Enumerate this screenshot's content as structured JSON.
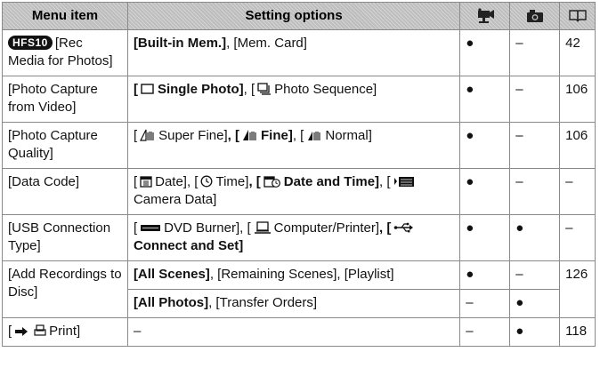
{
  "header": {
    "menu_item": "Menu item",
    "setting_options": "Setting options",
    "video_mode_icon": "video-camera-icon",
    "photo_mode_icon": "still-camera-icon",
    "page_ref_icon": "book-icon"
  },
  "rows": [
    {
      "item_badge": "HFS10",
      "item": "[Rec Media for Photos]",
      "opt_1": "[Built-in Mem.]",
      "opt_2": ", [Mem. Card]",
      "video": "●",
      "photo": "–",
      "page": "42"
    },
    {
      "item": "[Photo Capture from Video]",
      "opt_1_open": "[",
      "opt_1": "Single Photo]",
      "opt_2_open": ", [",
      "opt_2": "Photo Sequence]",
      "video": "●",
      "photo": "–",
      "page": "106"
    },
    {
      "item": "[Photo Capture Quality]",
      "opt_1_open": "[",
      "opt_1": "Super Fine]",
      "opt_2_open": ", [",
      "opt_2": "Fine]",
      "opt_3_open": ", [",
      "opt_3": "Normal]",
      "video": "●",
      "photo": "–",
      "page": "106"
    },
    {
      "item": "[Data Code]",
      "opt_1_open": "[",
      "opt_1": "Date]",
      "opt_2_open": ", [",
      "opt_2": "Time]",
      "opt_3_open": ", [",
      "opt_3": "Date and Time]",
      "opt_4_open": ", [",
      "opt_4": "Camera Data]",
      "video": "●",
      "photo": "–",
      "page": "–"
    },
    {
      "item": "[USB Connection Type]",
      "opt_1_open": "[",
      "opt_1": "DVD Burner]",
      "opt_2_open": ", [",
      "opt_2": "Computer/Printer]",
      "opt_3_open": ", [",
      "opt_3": "Connect and Set]",
      "video": "●",
      "photo": "●",
      "page": "–"
    },
    {
      "item": "[Add Recordings to Disc]",
      "opt_1": "[All Scenes]",
      "opt_2": ", [Remaining Scenes], [Playlist]",
      "video": "●",
      "photo": "–",
      "page": "126",
      "sub": {
        "opt_1": "[All Photos]",
        "opt_2": ", [Transfer Orders]",
        "video": "–",
        "photo": "●"
      }
    },
    {
      "item_open": "[",
      "item": "Print]",
      "options": "–",
      "video": "–",
      "photo": "●",
      "page": "118"
    }
  ]
}
